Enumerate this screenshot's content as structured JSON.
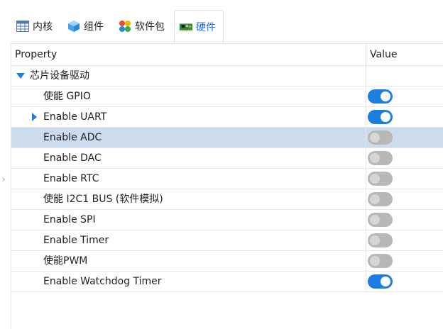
{
  "tabs": [
    {
      "label": "内核",
      "icon": "table-icon",
      "active": false
    },
    {
      "label": "组件",
      "icon": "cube-icon",
      "active": false
    },
    {
      "label": "软件包",
      "icon": "colorful-flower-icon",
      "active": false
    },
    {
      "label": "硬件",
      "icon": "circuit-board-icon",
      "active": true
    }
  ],
  "grid": {
    "header": {
      "property": "Property",
      "value": "Value"
    },
    "group": {
      "label": "芯片设备驱动",
      "expanded": true
    },
    "rows": [
      {
        "label": "使能 GPIO",
        "enabled": true
      },
      {
        "label": "Enable UART",
        "enabled": true
      },
      {
        "label": "Enable ADC",
        "enabled": false
      },
      {
        "label": "Enable DAC",
        "enabled": false
      },
      {
        "label": "Enable RTC",
        "enabled": false
      },
      {
        "label": "使能 I2C1 BUS (软件模拟)",
        "enabled": false
      },
      {
        "label": "Enable SPI",
        "enabled": false
      },
      {
        "label": "Enable Timer",
        "enabled": false
      },
      {
        "label": "使能PWM",
        "enabled": false
      },
      {
        "label": "Enable Watchdog Timer",
        "enabled": true
      }
    ],
    "selected_row": "Enable ADC"
  },
  "colors": {
    "accent": "#1a7fe0",
    "selection": "#cddcec",
    "toggle_off": "#b8b8b8"
  }
}
